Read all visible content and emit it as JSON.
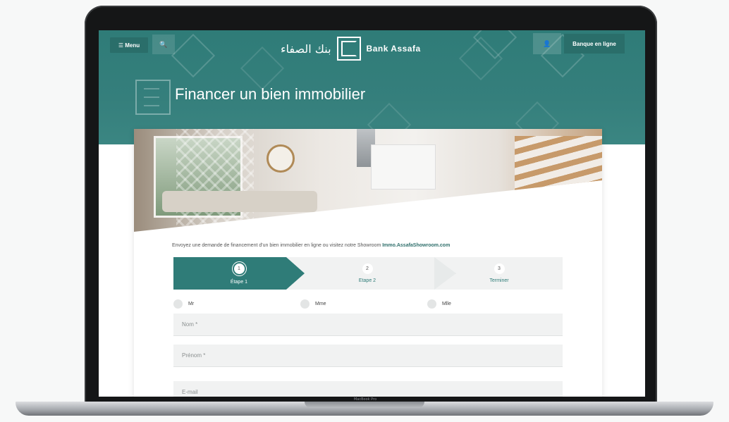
{
  "header": {
    "menu_label": "☰ Menu",
    "search_icon": "🔍",
    "logo_arabic": "بنك الصفاء",
    "logo_name": "Bank Assafa",
    "user_icon": "👤",
    "online_banking_label": "Banque en ligne"
  },
  "page": {
    "title": "Financer un bien immobilier",
    "intro_text": "Envoyez une demande de financement d'un bien immobilier en ligne ou visitez notre Showroom ",
    "intro_link": "Immo.AssafaShowroom.com"
  },
  "stepper": {
    "steps": [
      {
        "num": "1",
        "label": "Étape 1"
      },
      {
        "num": "2",
        "label": "Etape 2"
      },
      {
        "num": "3",
        "label": "Terminer"
      }
    ]
  },
  "form": {
    "civility": [
      {
        "label": "Mr"
      },
      {
        "label": "Mme"
      },
      {
        "label": "Mlle"
      }
    ],
    "fields": {
      "nom_placeholder": "Nom *",
      "prenom_placeholder": "Prénom *",
      "email_placeholder": "E-mail"
    }
  },
  "colors": {
    "brand": "#2f7c78",
    "brand_dark": "#2a6e6a"
  },
  "device": {
    "brand_label": "MacBook Pro"
  }
}
